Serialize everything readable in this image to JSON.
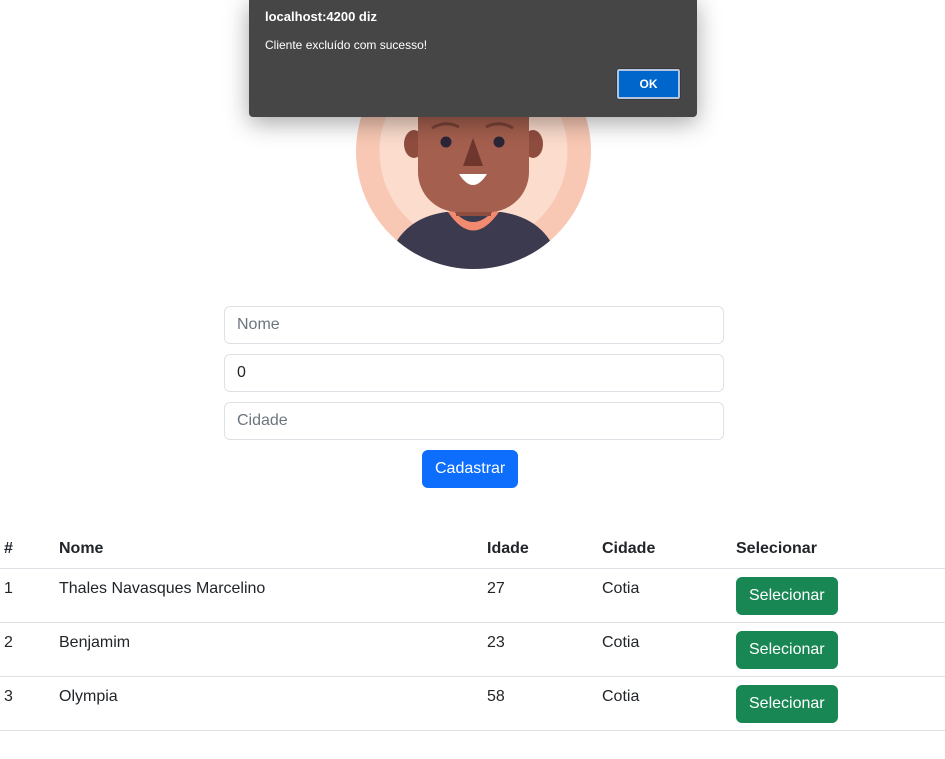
{
  "dialog": {
    "title": "localhost:4200 diz",
    "message": "Cliente excluído com sucesso!",
    "ok_label": "OK"
  },
  "form": {
    "nome_placeholder": "Nome",
    "nome_value": "",
    "idade_value": "0",
    "cidade_placeholder": "Cidade",
    "cidade_value": "",
    "submit_label": "Cadastrar"
  },
  "table": {
    "headers": [
      "#",
      "Nome",
      "Idade",
      "Cidade",
      "Selecionar"
    ],
    "rows": [
      {
        "id": "1",
        "nome": "Thales Navasques Marcelino",
        "idade": "27",
        "cidade": "Cotia",
        "action": "Selecionar"
      },
      {
        "id": "2",
        "nome": "Benjamim",
        "idade": "23",
        "cidade": "Cotia",
        "action": "Selecionar"
      },
      {
        "id": "3",
        "nome": "Olympia",
        "idade": "58",
        "cidade": "Cotia",
        "action": "Selecionar"
      }
    ]
  },
  "colors": {
    "primary": "#0d6efd",
    "success": "#198754",
    "dialog_bg": "#464646",
    "dialog_ok": "#0066cc"
  },
  "icons": {
    "avatar": "user-avatar-illustration"
  }
}
